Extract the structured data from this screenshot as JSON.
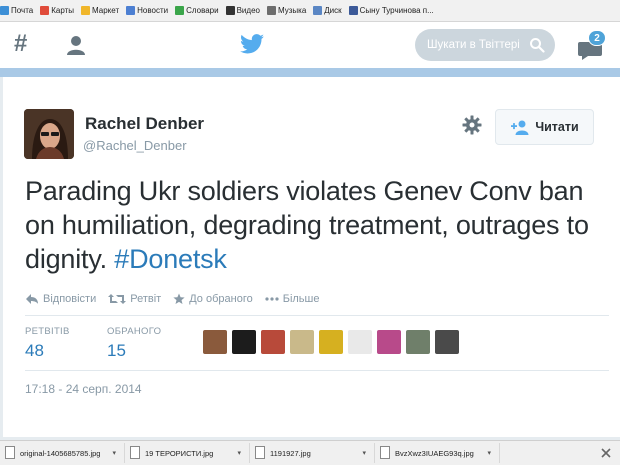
{
  "bookmarks": [
    {
      "label": "Почта",
      "color": "#3d8fd6"
    },
    {
      "label": "Карты",
      "color": "#e04b3a"
    },
    {
      "label": "Маркет",
      "color": "#f0b62a"
    },
    {
      "label": "Новости",
      "color": "#4c7fd2"
    },
    {
      "label": "Словари",
      "color": "#3aa54a"
    },
    {
      "label": "Видео",
      "color": "#333333"
    },
    {
      "label": "Музыка",
      "color": "#6d6d6d"
    },
    {
      "label": "Диск",
      "color": "#5a86c4"
    },
    {
      "label": "Сыну Турчинова п...",
      "color": "#3b5998"
    }
  ],
  "header": {
    "search_placeholder": "Шукати в Твіттері",
    "messages_badge": "2",
    "accent": "#55acee"
  },
  "tweet": {
    "name": "Rachel Denber",
    "handle": "@Rachel_Denber",
    "follow_label": "Читати",
    "text_main": "Parading Ukr soldiers violates Genev Conv ban on humiliation, degrading treatment, outrages to dignity.",
    "hashtag": "#Donetsk",
    "actions": {
      "reply": "Відповісти",
      "retweet": "Ретвіт",
      "favorite": "До обраного",
      "more": "Більше"
    },
    "stats": {
      "retweets_label": "РЕТВІТІВ",
      "retweets": "48",
      "favorites_label": "ОБРАНОГО",
      "favorites": "15"
    },
    "timestamp": "17:18 - 24 серп. 2014",
    "link_color": "#2b7bb9"
  },
  "downloads": [
    "original-1405685785.jpg",
    "19 ТЕРОРИСТИ.jpg",
    "1191927.jpg",
    "BvzXwz3IUAEG93q.jpg"
  ]
}
